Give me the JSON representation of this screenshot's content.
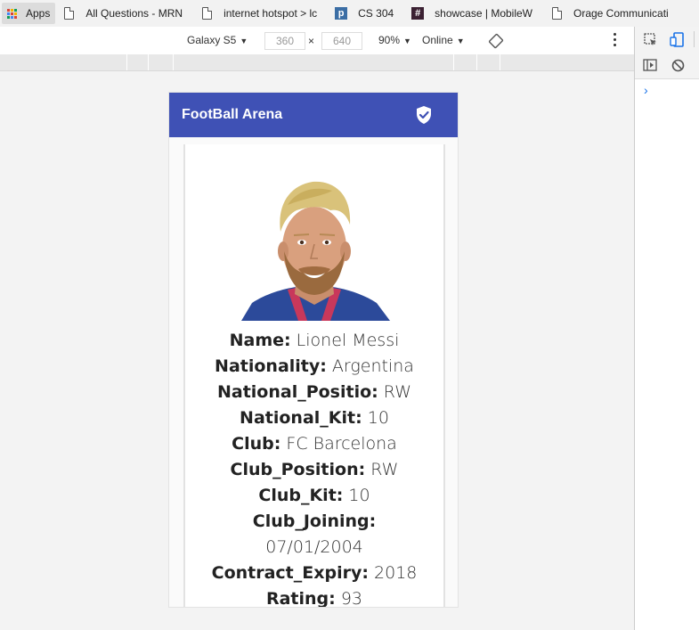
{
  "bookmarks": [
    {
      "icon": "apps-icon",
      "label": "Apps"
    },
    {
      "icon": "page-icon",
      "label": "All Questions - MRN"
    },
    {
      "icon": "page-icon",
      "label": "internet hotspot > lc"
    },
    {
      "icon": "p-icon",
      "label": "CS 304"
    },
    {
      "icon": "hash-icon",
      "label": "showcase | MobileW"
    },
    {
      "icon": "page-icon",
      "label": "Orage Communicati"
    }
  ],
  "device_toolbar": {
    "device": "Galaxy S5",
    "width": "360",
    "times": "×",
    "height": "640",
    "zoom": "90%",
    "network": "Online"
  },
  "app": {
    "title": "FootBall Arena",
    "brand_color": "#3f51b5"
  },
  "player": {
    "name_label": "Name:",
    "name": "Lionel Messi",
    "nationality_label": "Nationality:",
    "nationality": "Argentina",
    "national_position_label": "National_Positio:",
    "national_position": "RW",
    "national_kit_label": "National_Kit:",
    "national_kit": "10",
    "club_label": "Club:",
    "club": "FC Barcelona",
    "club_position_label": "Club_Position:",
    "club_position": "RW",
    "club_kit_label": "Club_Kit:",
    "club_kit": "10",
    "club_joining_label": "Club_Joining:",
    "club_joining": "07/01/2004",
    "contract_expiry_label": "Contract_Expiry:",
    "contract_expiry": "2018",
    "rating_label": "Rating:",
    "rating": "93"
  }
}
